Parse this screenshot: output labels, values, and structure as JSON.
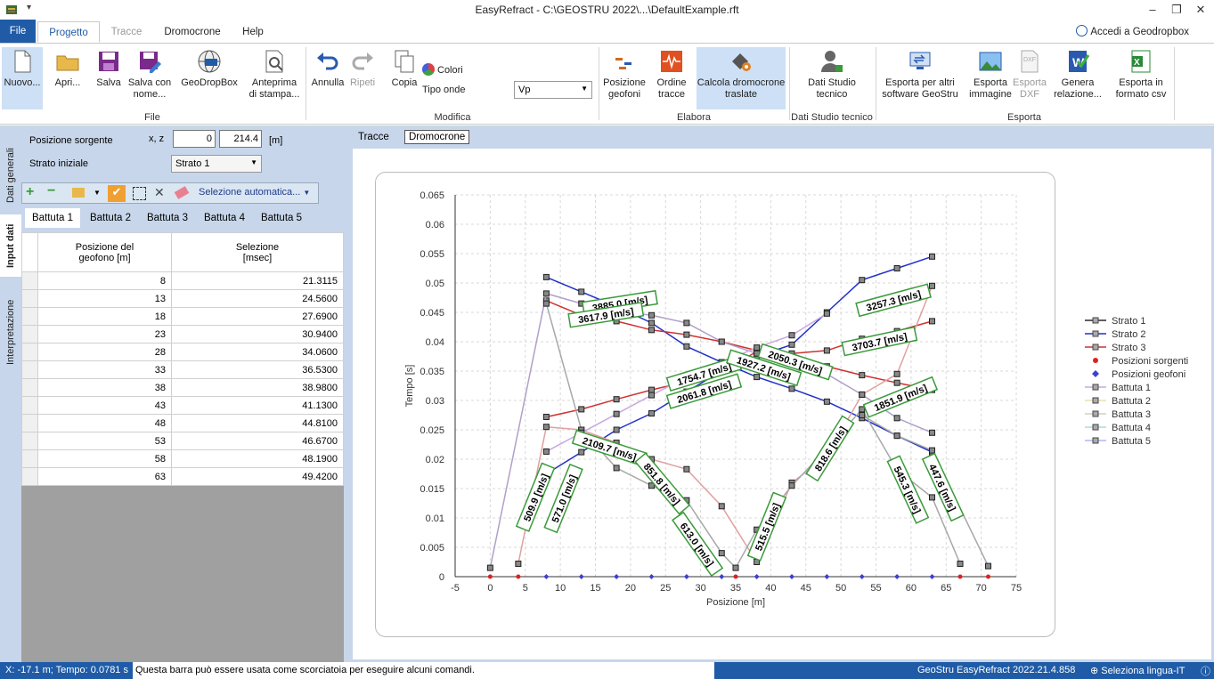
{
  "window": {
    "title": "EasyRefract - C:\\GEOSTRU 2022\\...\\DefaultExample.rft",
    "minimize": "–",
    "restore": "❐",
    "close": "✕"
  },
  "ribbon_tabs": [
    "File",
    "Progetto",
    "Tracce",
    "Dromocrone",
    "Help"
  ],
  "account": "Accedi a Geodropbox",
  "ribbon": {
    "file": {
      "nuovo": "Nuovo...",
      "apri": "Apri...",
      "salva": "Salva",
      "salva_con_nome": "Salva con nome...",
      "geodropbox": "GeoDropBox",
      "anteprima": "Anteprima di stampa..."
    },
    "modifica": {
      "annulla": "Annulla",
      "ripeti": "Ripeti",
      "copia": "Copia",
      "colori": "Colori",
      "tipo_onde": "Tipo onde",
      "tipo_onde_value": "Vp"
    },
    "elabora": {
      "posizione_geofoni": "Posizione geofoni",
      "ordine_tracce": "Ordine tracce",
      "calcola": "Calcola dromocrone traslate"
    },
    "dati_studio": {
      "dati_studio_tecnico": "Dati Studio tecnico"
    },
    "esporta": {
      "esporta_altri": "Esporta per altri software GeoStru",
      "esporta_immagine": "Esporta immagine",
      "esporta_dxf": "Esporta DXF",
      "genera_relazione": "Genera relazione...",
      "esporta_csv": "Esporta in formato csv"
    },
    "groups": {
      "file": "File",
      "modifica": "Modifica",
      "elabora": "Elabora",
      "dati_studio": "Dati Studio tecnico",
      "esporta": "Esporta"
    }
  },
  "side_tabs": [
    "Dati generali",
    "Input dati",
    "Interpretazione"
  ],
  "input": {
    "posizione_sorgente_label": "Posizione sorgente",
    "xz_label": "x, z",
    "x_value": "0",
    "z_value": "214.4",
    "unit": "[m]",
    "strato_iniziale_label": "Strato iniziale",
    "strato_iniziale_value": "Strato 1",
    "selezione_automatica": "Selezione automatica..."
  },
  "battute": [
    "Battuta 1",
    "Battuta 2",
    "Battuta 3",
    "Battuta 4",
    "Battuta 5"
  ],
  "table": {
    "headers": [
      "Posizione del geofono [m]",
      "Selezione [msec]"
    ],
    "rows": [
      [
        "8",
        "21.3115"
      ],
      [
        "13",
        "24.5600"
      ],
      [
        "18",
        "27.6900"
      ],
      [
        "23",
        "30.9400"
      ],
      [
        "28",
        "34.0600"
      ],
      [
        "33",
        "36.5300"
      ],
      [
        "38",
        "38.9800"
      ],
      [
        "43",
        "41.1300"
      ],
      [
        "48",
        "44.8100"
      ],
      [
        "53",
        "46.6700"
      ],
      [
        "58",
        "48.1900"
      ],
      [
        "63",
        "49.4200"
      ]
    ]
  },
  "chart_tabs": [
    "Tracce",
    "Dromocrone"
  ],
  "chart_data": {
    "type": "line",
    "xlabel": "Posizione [m]",
    "ylabel": "Tempo [s]",
    "xlim": [
      -5,
      75
    ],
    "ylim": [
      0,
      0.065
    ],
    "xticks": [
      -5,
      0,
      5,
      10,
      15,
      20,
      25,
      30,
      35,
      40,
      45,
      50,
      55,
      60,
      65,
      70,
      75
    ],
    "yticks": [
      0,
      0.005,
      0.01,
      0.015,
      0.02,
      0.025,
      0.03,
      0.035,
      0.04,
      0.045,
      0.05,
      0.055,
      0.06,
      0.065
    ],
    "grid": true,
    "legend": "right",
    "colors": {
      "strato1": "#444444",
      "strato2": "#2020c0",
      "strato3": "#c02020",
      "sorgenti": "#e02020",
      "geofoni": "#4040d0",
      "battuta1": "#c8a8e0",
      "battuta2": "#e8e0b0",
      "battuta3": "#d0d0c0",
      "battuta4": "#b0d8d8",
      "battuta5": "#b0b8e8"
    },
    "series": [
      {
        "name": "Strato 1",
        "color": "#2a2a2a"
      },
      {
        "name": "Strato 2",
        "color": "#2030c8"
      },
      {
        "name": "Strato 3",
        "color": "#d03030"
      },
      {
        "name": "Posizioni sorgenti",
        "color": "#e02020"
      },
      {
        "name": "Posizioni geofoni",
        "color": "#4040d0"
      },
      {
        "name": "Battuta 1",
        "color": "#c8a8e0"
      },
      {
        "name": "Battuta 2",
        "color": "#e8e0b0"
      },
      {
        "name": "Battuta 3",
        "color": "#d0d0c0"
      },
      {
        "name": "Battuta 4",
        "color": "#b0d8d8"
      },
      {
        "name": "Battuta 5",
        "color": "#b0b8e8"
      }
    ],
    "lines": [
      {
        "color": "#2030c8",
        "x": [
          8,
          13,
          18,
          23,
          28,
          33,
          38,
          43,
          48,
          53,
          58,
          63
        ],
        "y": [
          0.051,
          0.0485,
          0.046,
          0.0432,
          0.0392,
          0.0365,
          0.034,
          0.032,
          0.0298,
          0.027,
          0.024,
          0.0212
        ]
      },
      {
        "color": "#d03030",
        "x": [
          8,
          13,
          18,
          23,
          28,
          33,
          38,
          43,
          48,
          53,
          58,
          63
        ],
        "y": [
          0.047,
          0.0445,
          0.0435,
          0.042,
          0.0412,
          0.04,
          0.0385,
          0.0375,
          0.0358,
          0.0343,
          0.033,
          0.0318
        ]
      },
      {
        "color": "#d03030",
        "x": [
          8,
          13,
          18,
          23,
          28,
          33,
          38,
          43,
          48,
          53,
          58,
          63
        ],
        "y": [
          0.0272,
          0.0285,
          0.0302,
          0.0318,
          0.0332,
          0.035,
          0.0383,
          0.038,
          0.0385,
          0.0405,
          0.0418,
          0.0435
        ]
      },
      {
        "color": "#2030c8",
        "x": [
          8,
          13,
          18,
          23,
          28,
          33,
          38,
          43,
          48,
          53,
          58,
          63
        ],
        "y": [
          0.0175,
          0.0212,
          0.025,
          0.0278,
          0.0315,
          0.035,
          0.0375,
          0.0395,
          0.045,
          0.0505,
          0.0525,
          0.0545
        ]
      },
      {
        "color": "#b0a0c8",
        "x": [
          0,
          8,
          13,
          18,
          23,
          28,
          33,
          38,
          43,
          48,
          53,
          58,
          63
        ],
        "y": [
          0.0015,
          0.0482,
          0.0465,
          0.0452,
          0.0445,
          0.0432,
          0.04,
          0.038,
          0.037,
          0.0345,
          0.031,
          0.027,
          0.0245
        ]
      },
      {
        "color": "#e0a0a0",
        "x": [
          4,
          8,
          13,
          18,
          23,
          28,
          33,
          38,
          43,
          48,
          53,
          58,
          63
        ],
        "y": [
          0.0022,
          0.0255,
          0.025,
          0.0228,
          0.02,
          0.0183,
          0.012,
          0.0025,
          0.016,
          0.0205,
          0.031,
          0.0345,
          0.0495
        ]
      },
      {
        "color": "#a8a8a8",
        "x": [
          8,
          13,
          18,
          23,
          28,
          33,
          35,
          38,
          43,
          48,
          53,
          58,
          63,
          67
        ],
        "y": [
          0.0465,
          0.025,
          0.0185,
          0.0155,
          0.013,
          0.004,
          0.0015,
          0.008,
          0.0155,
          0.0218,
          0.0285,
          0.0182,
          0.0135,
          0.0022
        ]
      },
      {
        "color": "#c8a8e0",
        "x": [
          8,
          13,
          18,
          23,
          28,
          33,
          38,
          43,
          48
        ],
        "y": [
          0.0213,
          0.0245,
          0.0277,
          0.0309,
          0.034,
          0.0365,
          0.039,
          0.0411,
          0.0448
        ]
      },
      {
        "color": "#a8a8a8",
        "x": [
          53,
          58,
          63,
          71
        ],
        "y": [
          0.0275,
          0.024,
          0.0215,
          0.0018
        ]
      }
    ],
    "annotations": [
      {
        "text": "3885.0 [m/s]",
        "x": 18.5,
        "y": 0.0465,
        "rot": -9
      },
      {
        "text": "3617.9 [m/s]",
        "x": 16.5,
        "y": 0.0445,
        "rot": -9
      },
      {
        "text": "3257.3 [m/s]",
        "x": 57.5,
        "y": 0.047,
        "rot": -15
      },
      {
        "text": "3703.7 [m/s]",
        "x": 55.5,
        "y": 0.04,
        "rot": -12
      },
      {
        "text": "1754.7 [m/s]",
        "x": 30.5,
        "y": 0.0345,
        "rot": -17
      },
      {
        "text": "1927.2 [m/s]",
        "x": 39.0,
        "y": 0.0355,
        "rot": 18
      },
      {
        "text": "2050.3 [m/s]",
        "x": 43.5,
        "y": 0.0365,
        "rot": 18
      },
      {
        "text": "2061.8 [m/s]",
        "x": 30.5,
        "y": 0.0315,
        "rot": -17
      },
      {
        "text": "1851.9 [m/s]",
        "x": 58.5,
        "y": 0.0305,
        "rot": -22
      },
      {
        "text": "2109.7 [m/s]",
        "x": 17.0,
        "y": 0.0218,
        "rot": 18
      },
      {
        "text": "851.8 [m/s]",
        "x": 24.5,
        "y": 0.0158,
        "rot": 50
      },
      {
        "text": "613.0 [m/s]",
        "x": 29.5,
        "y": 0.0055,
        "rot": 55
      },
      {
        "text": "509.9 [m/s]",
        "x": 6.5,
        "y": 0.0135,
        "rot": -68
      },
      {
        "text": "571.0 [m/s]",
        "x": 10.5,
        "y": 0.0133,
        "rot": -68
      },
      {
        "text": "515.5 [m/s]",
        "x": 39.5,
        "y": 0.0085,
        "rot": -68
      },
      {
        "text": "818.6 [m/s]",
        "x": 48.5,
        "y": 0.0218,
        "rot": -58
      },
      {
        "text": "545.3 [m/s]",
        "x": 59.5,
        "y": 0.0148,
        "rot": 65
      },
      {
        "text": "447.6 [m/s]",
        "x": 64.5,
        "y": 0.0152,
        "rot": 65
      }
    ],
    "sources": [
      0,
      4,
      35,
      67,
      71
    ],
    "geophones": [
      8,
      13,
      18,
      23,
      28,
      33,
      38,
      43,
      48,
      53,
      58,
      63
    ]
  },
  "status": {
    "coords": "X: -17.1 m; Tempo: 0.0781 s",
    "hint": "Questa barra può essere usata come scorciatoia per eseguire alcuni comandi.",
    "version": "GeoStru EasyRefract 2022.21.4.858",
    "language": "Seleziona lingua-IT"
  }
}
